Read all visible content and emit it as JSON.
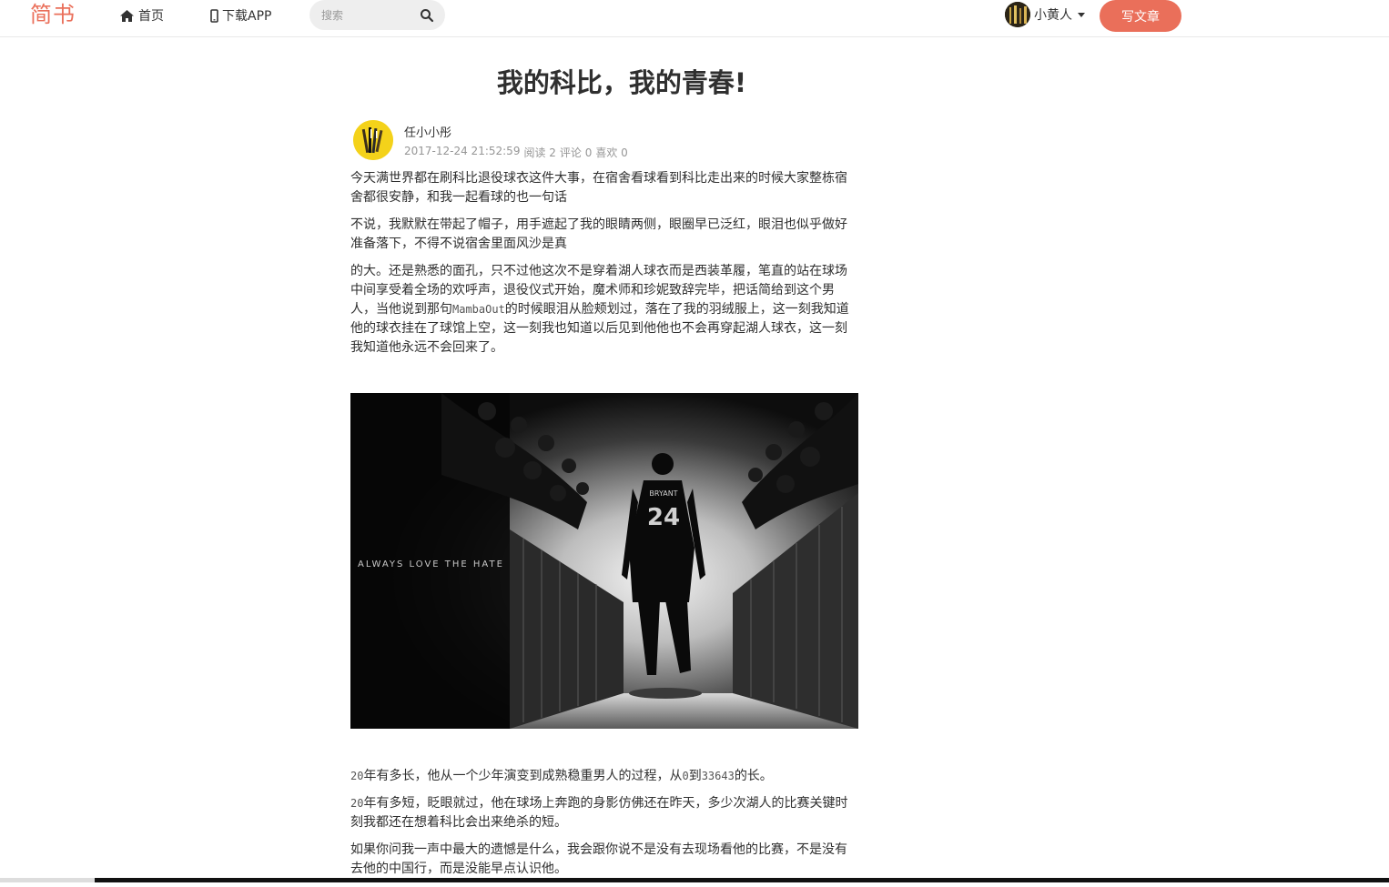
{
  "header": {
    "logo": "简书",
    "nav_home": "首页",
    "nav_app": "下载APP",
    "search_placeholder": "搜索",
    "username": "小黄人",
    "write_label": "写文章",
    "accent": "#ea6f5a"
  },
  "article": {
    "title": "我的科比，我的青春!",
    "author": "任小小彤",
    "datetime": "2017-12-24 21:52:59",
    "reads": "阅读 2",
    "comments": "评论 0",
    "likes": "喜欢 0",
    "p1": "今天满世界都在刷科比退役球衣这件大事，在宿舍看球看到科比走出来的时候大家整栋宿舍都很安静，和我一起看球的也一句话",
    "p2": "不说，我默默在带起了帽子，用手遮起了我的眼睛两侧，眼圈早已泛红，眼泪也似乎做好准备落下，不得不说宿舍里面风沙是真",
    "p3_a": "的大。还是熟悉的面孔，只不过他这次不是穿着湖人球衣而是西装革履，笔直的站在球场中间享受着全场的欢呼声，退役仪式开始，魔术师和珍妮致辞完毕，把话简给到这个男人，当他说到那句",
    "p3_code": "MambaOut",
    "p3_b": "的时候眼泪从脸颊划过，落在了我的羽绒服上，这一刻我知道他的球衣挂在了球馆上空，这一刻我也知道以后见到他他也不会再穿起湖人球衣，这一刻我知道他永远不会回来了。",
    "image_caption": "ALWAYS LOVE THE HATE",
    "jersey_number": "24",
    "jersey_name": "BRYANT",
    "p4_n1": "20",
    "p4_a": "年有多长，他从一个少年演变到成熟稳重男人的过程，从",
    "p4_n2": "0",
    "p4_b": "到",
    "p4_n3": "33643",
    "p4_c": "的长。",
    "p5_n1": "20",
    "p5_a": "年有多短，眨眼就过，他在球场上奔跑的身影仿佛还在昨天，多少次湖人的比赛关键时刻我都还在想着科比会出来绝杀的短。",
    "p6": "如果你问我一声中最大的遗憾是什么，我会跟你说不是没有去现场看他的比赛，不是没有去他的中国行，而是没能早点认识他。"
  },
  "icons": {
    "home": "home-icon",
    "phone": "phone-icon",
    "search": "search-icon",
    "caret": "caret-down-icon"
  }
}
